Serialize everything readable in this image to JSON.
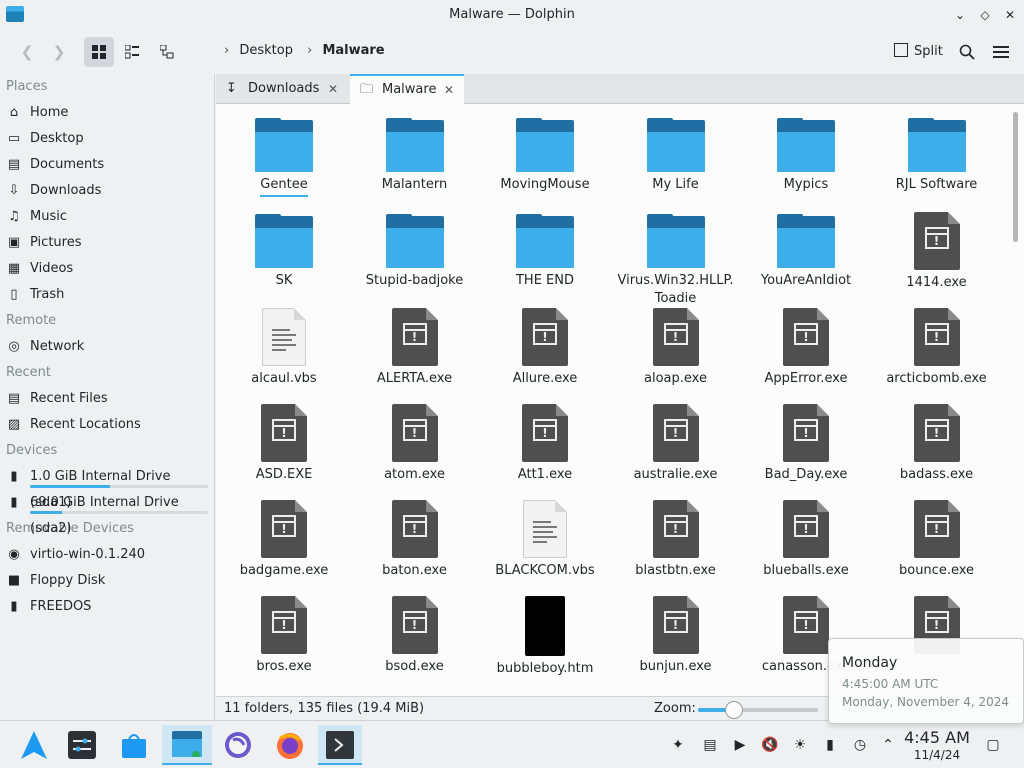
{
  "window": {
    "title": "Malware — Dolphin"
  },
  "toolbar": {
    "breadcrumb": [
      "Desktop",
      "Malware"
    ],
    "split_label": "Split"
  },
  "sidebar": {
    "sections": [
      {
        "title": "Places",
        "items": [
          {
            "label": "Home",
            "icon": "home-icon"
          },
          {
            "label": "Desktop",
            "icon": "desktop-icon"
          },
          {
            "label": "Documents",
            "icon": "documents-icon"
          },
          {
            "label": "Downloads",
            "icon": "downloads-icon"
          },
          {
            "label": "Music",
            "icon": "music-icon"
          },
          {
            "label": "Pictures",
            "icon": "pictures-icon"
          },
          {
            "label": "Videos",
            "icon": "videos-icon"
          },
          {
            "label": "Trash",
            "icon": "trash-icon"
          }
        ]
      },
      {
        "title": "Remote",
        "items": [
          {
            "label": "Network",
            "icon": "network-icon"
          }
        ]
      },
      {
        "title": "Recent",
        "items": [
          {
            "label": "Recent Files",
            "icon": "recent-files-icon"
          },
          {
            "label": "Recent Locations",
            "icon": "recent-locations-icon"
          }
        ]
      },
      {
        "title": "Devices",
        "items": [
          {
            "label": "1.0 GiB Internal Drive (sda1)",
            "icon": "drive-icon",
            "usage": 0.45
          },
          {
            "label": "69.0 GiB Internal Drive (sda2)",
            "icon": "drive-icon",
            "usage": 0.18
          }
        ]
      },
      {
        "title": "Removable Devices",
        "items": [
          {
            "label": "virtio-win-0.1.240",
            "icon": "optical-disc-icon"
          },
          {
            "label": "Floppy Disk",
            "icon": "floppy-icon"
          },
          {
            "label": "FREEDOS",
            "icon": "usb-drive-icon"
          }
        ]
      }
    ]
  },
  "tabs": [
    {
      "label": "Downloads",
      "active": false
    },
    {
      "label": "Malware",
      "active": true
    }
  ],
  "files": [
    {
      "name": "Gentee",
      "type": "folder"
    },
    {
      "name": "Malantern",
      "type": "folder"
    },
    {
      "name": "MovingMouse",
      "type": "folder"
    },
    {
      "name": "My Life",
      "type": "folder"
    },
    {
      "name": "Mypics",
      "type": "folder"
    },
    {
      "name": "RJL Software",
      "type": "folder"
    },
    {
      "name": "SK",
      "type": "folder"
    },
    {
      "name": "Stupid-badjoke",
      "type": "folder"
    },
    {
      "name": "THE END",
      "type": "folder"
    },
    {
      "name": "Virus.Win32.HLLP.",
      "name2": "Toadie",
      "type": "folder"
    },
    {
      "name": "YouAreAnIdiot",
      "type": "folder"
    },
    {
      "name": "1414.exe",
      "type": "exe"
    },
    {
      "name": "alcaul.vbs",
      "type": "vbs"
    },
    {
      "name": "ALERTA.exe",
      "type": "exe"
    },
    {
      "name": "Allure.exe",
      "type": "exe"
    },
    {
      "name": "aloap.exe",
      "type": "exe"
    },
    {
      "name": "AppError.exe",
      "type": "exe"
    },
    {
      "name": "arcticbomb.exe",
      "type": "exe"
    },
    {
      "name": "ASD.EXE",
      "type": "exe"
    },
    {
      "name": "atom.exe",
      "type": "exe"
    },
    {
      "name": "Att1.exe",
      "type": "exe"
    },
    {
      "name": "australie.exe",
      "type": "exe"
    },
    {
      "name": "Bad_Day.exe",
      "type": "exe"
    },
    {
      "name": "badass.exe",
      "type": "exe"
    },
    {
      "name": "badgame.exe",
      "type": "exe"
    },
    {
      "name": "baton.exe",
      "type": "exe"
    },
    {
      "name": "BLACKCOM.vbs",
      "type": "vbs"
    },
    {
      "name": "blastbtn.exe",
      "type": "exe"
    },
    {
      "name": "blueballs.exe",
      "type": "exe"
    },
    {
      "name": "bounce.exe",
      "type": "exe"
    },
    {
      "name": "bros.exe",
      "type": "exe"
    },
    {
      "name": "bsod.exe",
      "type": "exe"
    },
    {
      "name": "bubbleboy.htm",
      "type": "htm"
    },
    {
      "name": "bunjun.exe",
      "type": "exe"
    },
    {
      "name": "canasson.exe",
      "type": "exe"
    },
    {
      "name": "",
      "type": "exe"
    }
  ],
  "statusbar": {
    "info": "11 folders, 135 files (19.4 MiB)",
    "zoom_label": "Zoom:",
    "zoom_level": 0.3
  },
  "taskbar": {
    "clock_time": "4:45 AM",
    "clock_date": "11/4/24"
  },
  "tooltip": {
    "heading": "Monday",
    "line1": "4:45:00 AM UTC",
    "line2": "Monday, November 4, 2024"
  },
  "colors": {
    "accent": "#3daee9",
    "folder_back": "#1f6fa3",
    "exe_gray": "#4f4f4f"
  }
}
